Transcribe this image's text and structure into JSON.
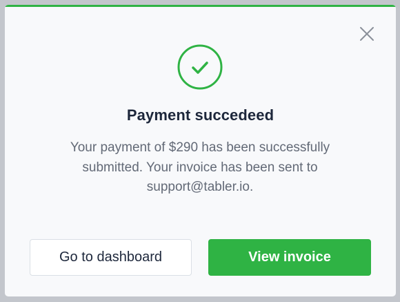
{
  "modal": {
    "status_color": "#2fb344",
    "icon": "circle-check-icon",
    "close_icon": "close-icon",
    "title": "Payment succedeed",
    "message_lines": [
      "Your payment of $290 has been successfully",
      "submitted. Your invoice has been sent to",
      "support@tabler.io."
    ],
    "buttons": {
      "secondary_label": "Go to dashboard",
      "primary_label": "View invoice"
    }
  }
}
